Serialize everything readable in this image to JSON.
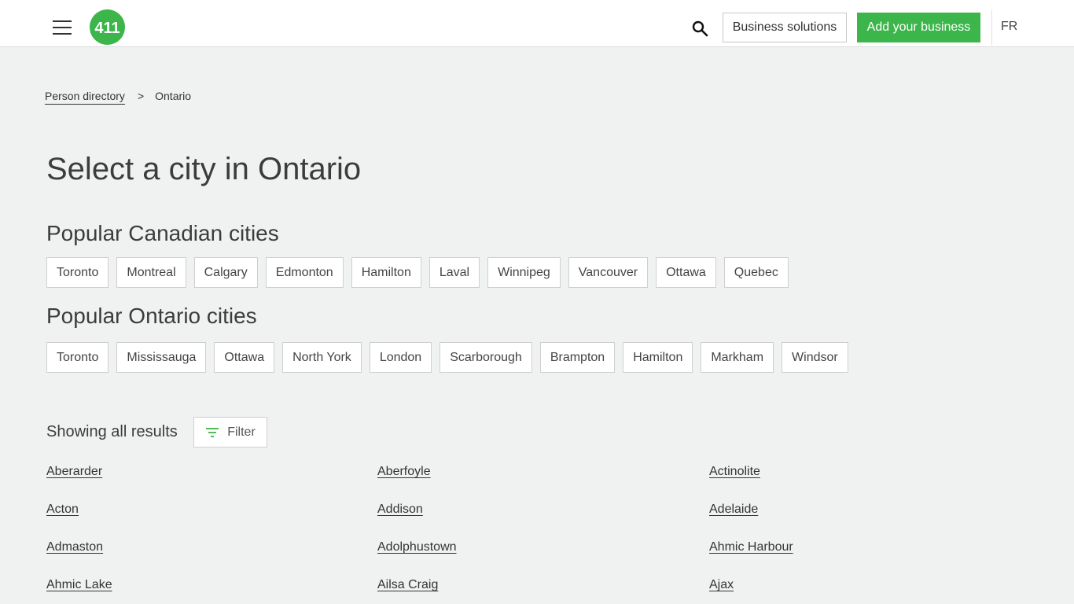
{
  "header": {
    "logo_text": "411",
    "brand_color": "#3cb54a",
    "business_solutions_label": "Business solutions",
    "add_business_label": "Add your business",
    "language_label": "FR"
  },
  "breadcrumb": {
    "items": [
      {
        "label": "Person directory"
      },
      {
        "label": "Ontario"
      }
    ],
    "separator": ">"
  },
  "page_title": "Select a city in Ontario",
  "popular_canadian": {
    "title": "Popular Canadian cities",
    "cities": [
      "Toronto",
      "Montreal",
      "Calgary",
      "Edmonton",
      "Hamilton",
      "Laval",
      "Winnipeg",
      "Vancouver",
      "Ottawa",
      "Quebec"
    ]
  },
  "popular_ontario": {
    "title": "Popular Ontario cities",
    "cities": [
      "Toronto",
      "Mississauga",
      "Ottawa",
      "North York",
      "London",
      "Scarborough",
      "Brampton",
      "Hamilton",
      "Markham",
      "Windsor"
    ]
  },
  "results": {
    "showing_label": "Showing all results",
    "filter_label": "Filter",
    "cities": [
      "Aberarder",
      "Aberfoyle",
      "Actinolite",
      "Acton",
      "Addison",
      "Adelaide",
      "Admaston",
      "Adolphustown",
      "Ahmic Harbour",
      "Ahmic Lake",
      "Ailsa Craig",
      "Ajax"
    ]
  },
  "icons": {
    "menu": "hamburger-menu-icon",
    "search": "search-icon",
    "filter": "filter-icon"
  }
}
